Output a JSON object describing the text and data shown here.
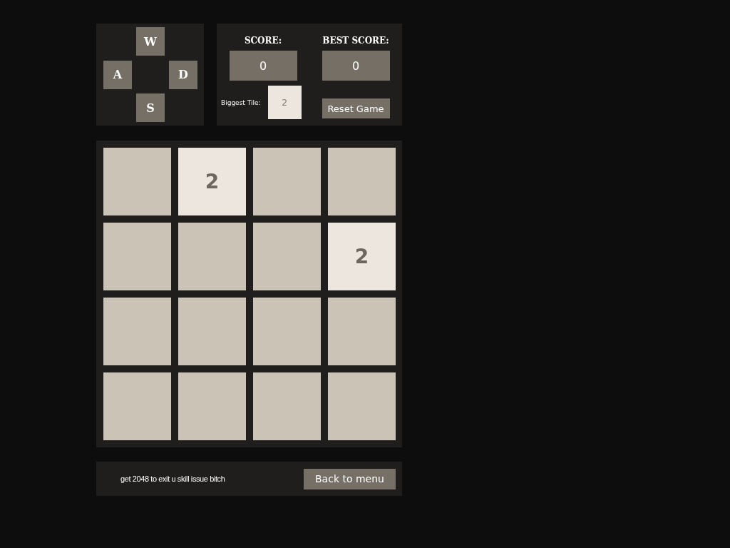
{
  "keys": [
    {
      "label": "W",
      "kind": "up"
    },
    {
      "label": "A",
      "kind": "left"
    },
    {
      "label": "D",
      "kind": "right"
    },
    {
      "label": "S",
      "kind": "down"
    }
  ],
  "score": {
    "label": "SCORE:",
    "value": "0"
  },
  "best_score": {
    "label": "BEST SCORE:",
    "value": "0"
  },
  "biggest_tile": {
    "label": "Biggest Tile:",
    "value": "2"
  },
  "reset_button": "Reset Game",
  "board": [
    [
      {
        "kind": "empty"
      },
      {
        "kind": "tile",
        "value": "2"
      },
      {
        "kind": "empty"
      },
      {
        "kind": "empty"
      }
    ],
    [
      {
        "kind": "empty"
      },
      {
        "kind": "empty"
      },
      {
        "kind": "empty"
      },
      {
        "kind": "tile",
        "value": "2"
      }
    ],
    [
      {
        "kind": "empty"
      },
      {
        "kind": "empty"
      },
      {
        "kind": "empty"
      },
      {
        "kind": "empty"
      }
    ],
    [
      {
        "kind": "empty"
      },
      {
        "kind": "empty"
      },
      {
        "kind": "empty"
      },
      {
        "kind": "empty"
      }
    ]
  ],
  "footer": {
    "message": "get 2048 to exit u skill issue bitch",
    "button": "Back to menu"
  }
}
